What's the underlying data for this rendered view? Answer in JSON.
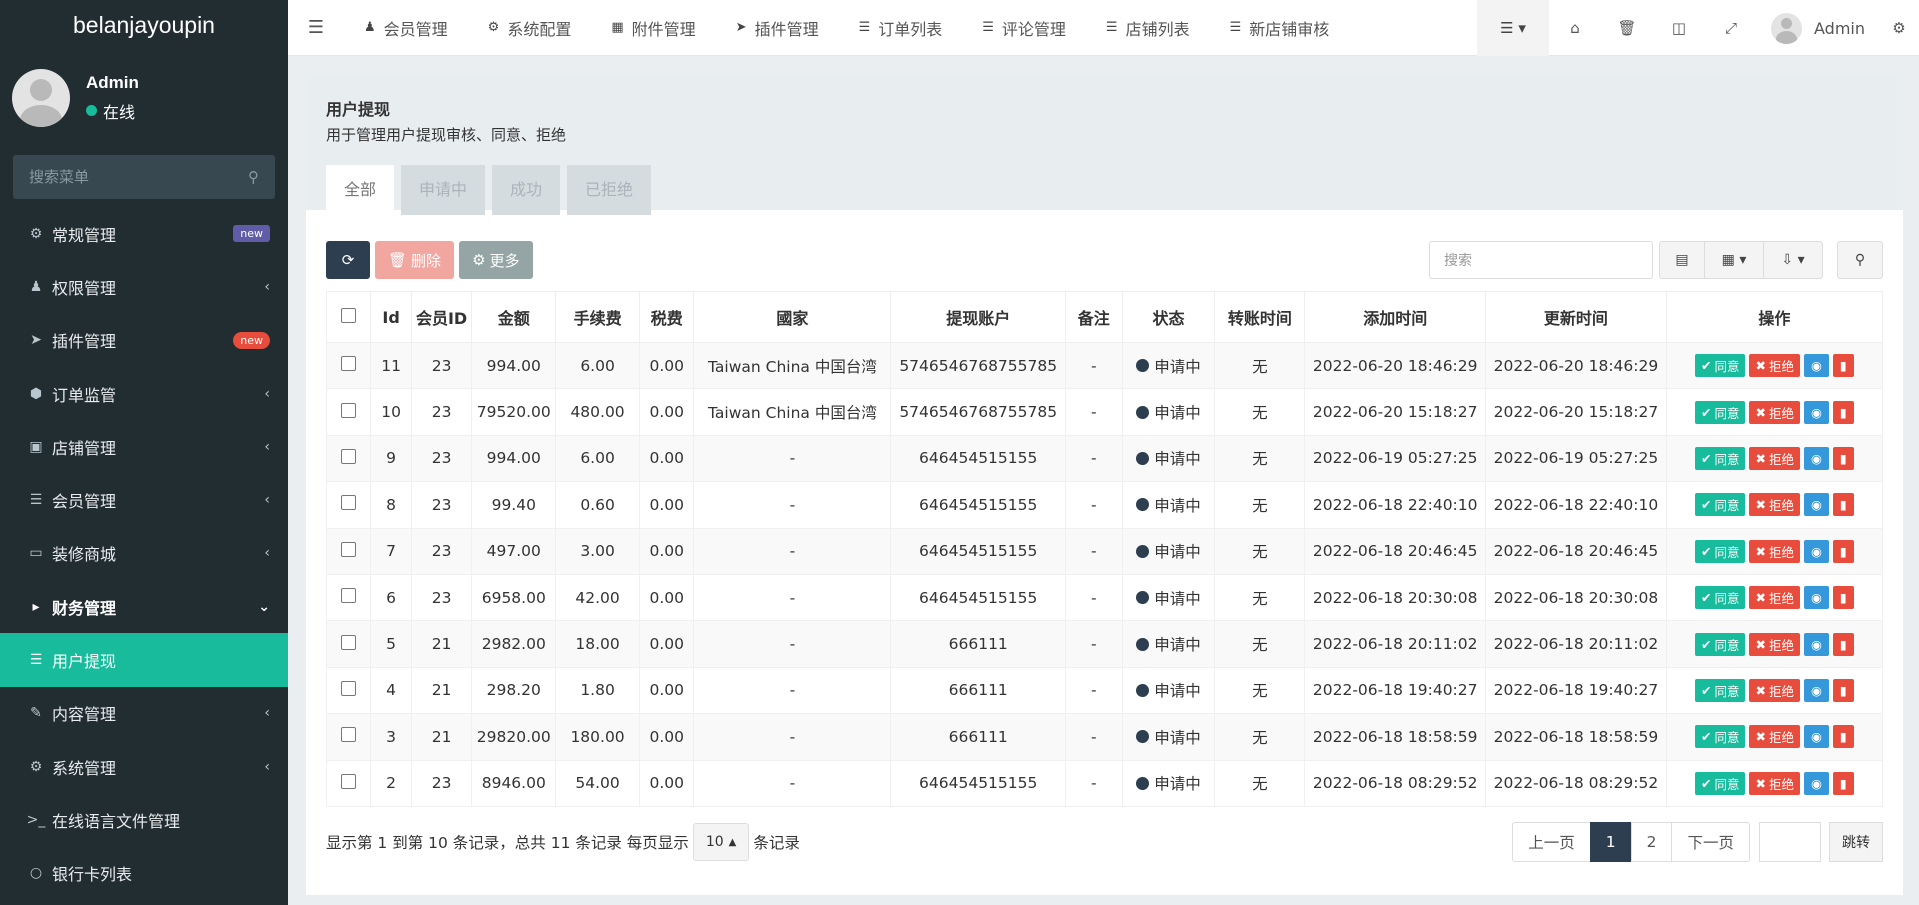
{
  "brand": "belanjayoupin",
  "user": {
    "name": "Admin",
    "status": "在线"
  },
  "sidebar": {
    "search_placeholder": "搜索菜单",
    "items": [
      {
        "label": "常规管理",
        "icon": "cogs-icon",
        "badge": "new"
      },
      {
        "label": "权限管理",
        "icon": "group-icon"
      },
      {
        "label": "插件管理",
        "icon": "rocket-icon",
        "badge": "new"
      },
      {
        "label": "订单监管",
        "icon": "cube-icon"
      },
      {
        "label": "店铺管理",
        "icon": "archive-icon"
      },
      {
        "label": "会员管理",
        "icon": "list-icon"
      },
      {
        "label": "装修商城",
        "icon": "desktop-icon"
      },
      {
        "label": "财务管理",
        "icon": "wallet-icon"
      },
      {
        "label": "用户提现",
        "icon": "list-icon"
      },
      {
        "label": "内容管理",
        "icon": "edit-icon"
      },
      {
        "label": "系统管理",
        "icon": "gear-icon"
      },
      {
        "label": "在线语言文件管理",
        "icon": "terminal-icon"
      },
      {
        "label": "银行卡列表",
        "icon": "circle-icon"
      }
    ]
  },
  "topnav": {
    "items": [
      {
        "label": "会员管理",
        "icon": "user-icon"
      },
      {
        "label": "系统配置",
        "icon": "gear-icon"
      },
      {
        "label": "附件管理",
        "icon": "image-icon"
      },
      {
        "label": "插件管理",
        "icon": "rocket-icon"
      },
      {
        "label": "订单列表",
        "icon": "list-icon"
      },
      {
        "label": "评论管理",
        "icon": "list-icon"
      },
      {
        "label": "店铺列表",
        "icon": "list-icon"
      },
      {
        "label": "新店铺审核",
        "icon": "list-icon"
      }
    ],
    "user": "Admin"
  },
  "page": {
    "title": "用户提现",
    "description": "用于管理用户提现审核、同意、拒绝",
    "tabs": [
      "全部",
      "申请中",
      "成功",
      "已拒绝"
    ]
  },
  "toolbar": {
    "delete_label": "删除",
    "more_label": "更多",
    "search_placeholder": "搜索"
  },
  "table": {
    "headers": [
      "Id",
      "会员ID",
      "金额",
      "手续费",
      "税费",
      "國家",
      "提现账户",
      "备注",
      "状态",
      "转账时间",
      "添加时间",
      "更新时间",
      "操作"
    ],
    "rows": [
      {
        "id": "11",
        "member": "23",
        "amount": "994.00",
        "fee": "6.00",
        "tax": "0.00",
        "country": "Taiwan China 中国台湾",
        "account": "5746546768755785",
        "note": "-",
        "status": "申请中",
        "transfer": "无",
        "created": "2022-06-20 18:46:29",
        "updated": "2022-06-20 18:46:29"
      },
      {
        "id": "10",
        "member": "23",
        "amount": "79520.00",
        "fee": "480.00",
        "tax": "0.00",
        "country": "Taiwan China 中国台湾",
        "account": "5746546768755785",
        "note": "-",
        "status": "申请中",
        "transfer": "无",
        "created": "2022-06-20 15:18:27",
        "updated": "2022-06-20 15:18:27"
      },
      {
        "id": "9",
        "member": "23",
        "amount": "994.00",
        "fee": "6.00",
        "tax": "0.00",
        "country": "-",
        "account": "646454515155",
        "note": "-",
        "status": "申请中",
        "transfer": "无",
        "created": "2022-06-19 05:27:25",
        "updated": "2022-06-19 05:27:25"
      },
      {
        "id": "8",
        "member": "23",
        "amount": "99.40",
        "fee": "0.60",
        "tax": "0.00",
        "country": "-",
        "account": "646454515155",
        "note": "-",
        "status": "申请中",
        "transfer": "无",
        "created": "2022-06-18 22:40:10",
        "updated": "2022-06-18 22:40:10"
      },
      {
        "id": "7",
        "member": "23",
        "amount": "497.00",
        "fee": "3.00",
        "tax": "0.00",
        "country": "-",
        "account": "646454515155",
        "note": "-",
        "status": "申请中",
        "transfer": "无",
        "created": "2022-06-18 20:46:45",
        "updated": "2022-06-18 20:46:45"
      },
      {
        "id": "6",
        "member": "23",
        "amount": "6958.00",
        "fee": "42.00",
        "tax": "0.00",
        "country": "-",
        "account": "646454515155",
        "note": "-",
        "status": "申请中",
        "transfer": "无",
        "created": "2022-06-18 20:30:08",
        "updated": "2022-06-18 20:30:08"
      },
      {
        "id": "5",
        "member": "21",
        "amount": "2982.00",
        "fee": "18.00",
        "tax": "0.00",
        "country": "-",
        "account": "666111",
        "note": "-",
        "status": "申请中",
        "transfer": "无",
        "created": "2022-06-18 20:11:02",
        "updated": "2022-06-18 20:11:02"
      },
      {
        "id": "4",
        "member": "21",
        "amount": "298.20",
        "fee": "1.80",
        "tax": "0.00",
        "country": "-",
        "account": "666111",
        "note": "-",
        "status": "申请中",
        "transfer": "无",
        "created": "2022-06-18 19:40:27",
        "updated": "2022-06-18 19:40:27"
      },
      {
        "id": "3",
        "member": "21",
        "amount": "29820.00",
        "fee": "180.00",
        "tax": "0.00",
        "country": "-",
        "account": "666111",
        "note": "-",
        "status": "申请中",
        "transfer": "无",
        "created": "2022-06-18 18:58:59",
        "updated": "2022-06-18 18:58:59"
      },
      {
        "id": "2",
        "member": "23",
        "amount": "8946.00",
        "fee": "54.00",
        "tax": "0.00",
        "country": "-",
        "account": "646454515155",
        "note": "-",
        "status": "申请中",
        "transfer": "无",
        "created": "2022-06-18 08:29:52",
        "updated": "2022-06-18 08:29:52"
      }
    ],
    "actions": {
      "approve": "同意",
      "reject": "拒绝"
    }
  },
  "footer": {
    "summary": "显示第 1 到第 10 条记录，总共 11 条记录 每页显示",
    "page_size": "10",
    "suffix": "条记录"
  },
  "pagination": {
    "prev": "上一页",
    "pages": [
      "1",
      "2"
    ],
    "current": "1",
    "next": "下一页",
    "go": "跳转"
  },
  "colors": {
    "sidebar_bg": "#222d32",
    "accent": "#18bc9c",
    "danger": "#e74c3c",
    "info": "#3498db",
    "primary_dark": "#2c3e50"
  }
}
